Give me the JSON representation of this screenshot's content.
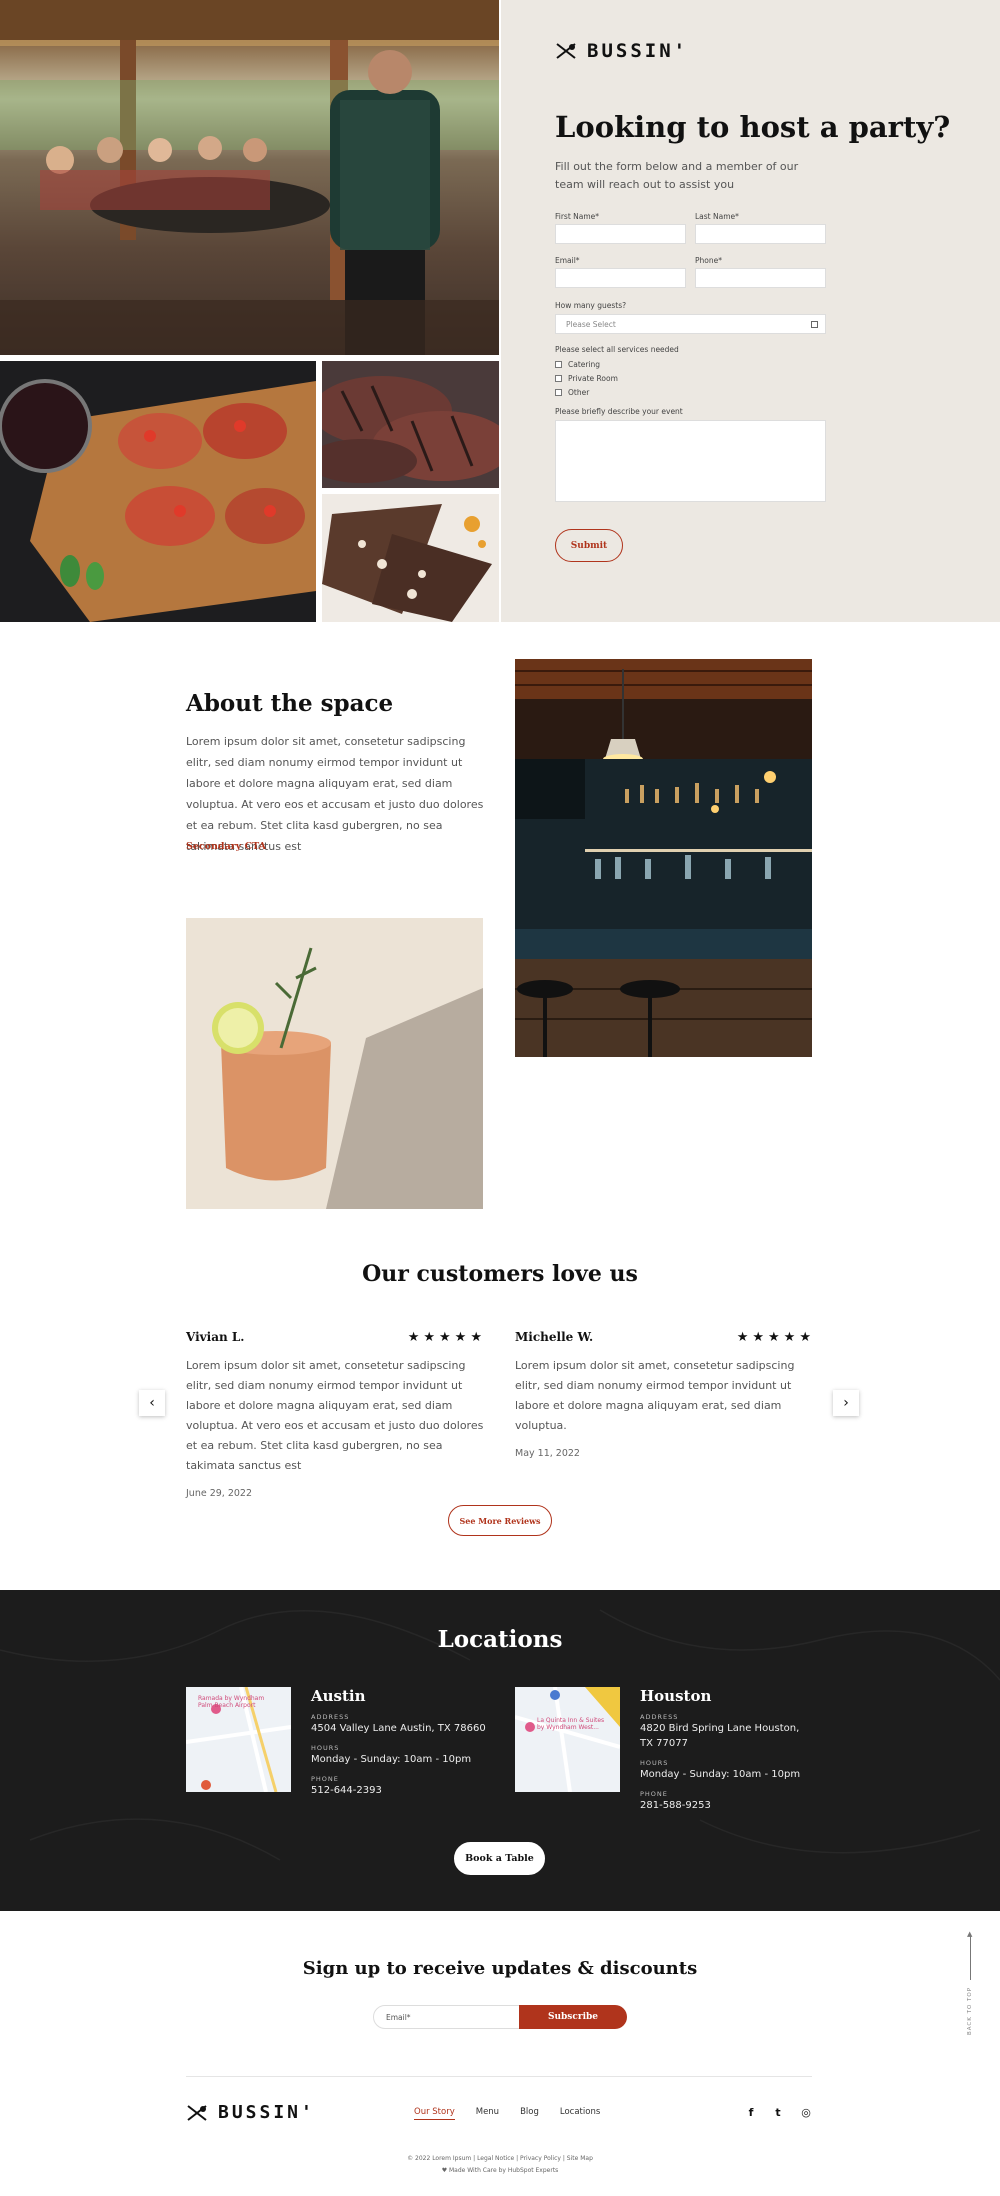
{
  "brand": {
    "name": "BUSSIN'"
  },
  "form": {
    "title": "Looking to host a party?",
    "intro": "Fill out the form below and a member of our team will reach out to assist you",
    "first_name_label": "First Name*",
    "last_name_label": "Last Name*",
    "email_label": "Email*",
    "phone_label": "Phone*",
    "guests_label": "How many guests?",
    "guests_placeholder": "Please Select",
    "services_label": "Please select all services needed",
    "services": [
      "Catering",
      "Private Room",
      "Other"
    ],
    "describe_label": "Please briefly describe your event",
    "submit_label": "Submit"
  },
  "about": {
    "title": "About the space",
    "body": "Lorem ipsum dolor sit amet, consetetur sadipscing elitr, sed diam nonumy eirmod tempor invidunt ut labore et dolore magna aliquyam erat, sed diam voluptua. At vero eos et accusam et justo duo dolores et ea rebum. Stet clita kasd gubergren, no sea takimata sanctus est",
    "cta": "Secondary CTA"
  },
  "reviews": {
    "title": "Our customers love us",
    "items": [
      {
        "name": "Vivian L.",
        "stars": "★★★★★",
        "rating": 5,
        "text": "Lorem ipsum dolor sit amet, consetetur sadipscing elitr, sed diam nonumy eirmod tempor invidunt ut labore et dolore magna aliquyam erat, sed diam voluptua. At vero eos et accusam et justo duo dolores et ea rebum. Stet clita kasd gubergren, no sea takimata sanctus est",
        "date": "June 29, 2022"
      },
      {
        "name": "Michelle W.",
        "stars": "★★★★★",
        "rating": 5,
        "text": "Lorem ipsum dolor sit amet, consetetur sadipscing elitr, sed diam nonumy eirmod tempor invidunt ut labore et dolore magna aliquyam erat, sed diam voluptua.",
        "date": "May 11, 2022"
      }
    ],
    "prev_icon": "‹",
    "next_icon": "›",
    "more_label": "See More Reviews"
  },
  "locations": {
    "title": "Locations",
    "address_key": "ADDRESS",
    "hours_key": "HOURS",
    "phone_key": "PHONE",
    "items": [
      {
        "city": "Austin",
        "address": "4504 Valley Lane Austin, TX 78660",
        "hours": "Monday - Sunday:  10am - 10pm",
        "phone": "512-644-2393",
        "map_label": "Ramada by Wyndham Palm Beach Airport"
      },
      {
        "city": "Houston",
        "address": "4820 Bird Spring Lane Houston, TX 77077",
        "hours": "Monday - Sunday:  10am - 10pm",
        "phone": "281-588-9253",
        "map_label": "La Quinta Inn & Suites by Wyndham West..."
      }
    ],
    "book_label": "Book a Table"
  },
  "signup": {
    "title": "Sign up to receive updates & discounts",
    "email_placeholder": "Email*",
    "button_label": "Subscribe",
    "back_to_top": "BACK TO TOP"
  },
  "footer": {
    "nav": [
      "Our Story",
      "Menu",
      "Blog",
      "Locations"
    ],
    "copyright": "© 2022 Lorem Ipsum  |  Legal Notice  |  Privacy Policy  |  Site Map",
    "made": "Made With Care by HubSpot Experts",
    "social": {
      "facebook": "f",
      "twitter": "t",
      "instagram": "◎"
    }
  },
  "colors": {
    "accent": "#b0341c",
    "panel": "#ece8e2",
    "dark": "#1c1c1c"
  }
}
